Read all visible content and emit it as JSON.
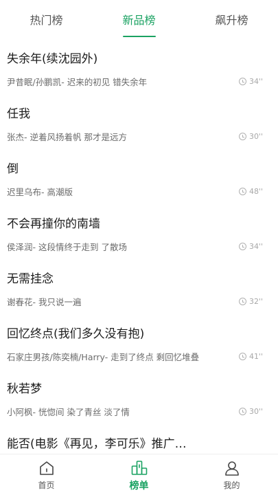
{
  "tabs": [
    {
      "label": "热门榜",
      "active": false
    },
    {
      "label": "新品榜",
      "active": true
    },
    {
      "label": "飙升榜",
      "active": false
    }
  ],
  "songs": [
    {
      "title": "失余年(续沈园外)",
      "subtitle": "尹昔眠/孙鹏凯- 迟来的初见 错失余年",
      "duration": "34''"
    },
    {
      "title": "任我",
      "subtitle": "张杰- 逆着风扬着帆 那才是远方",
      "duration": "30''"
    },
    {
      "title": "倒",
      "subtitle": "迟里乌布- 高潮版",
      "duration": "48''"
    },
    {
      "title": "不会再撞你的南墙",
      "subtitle": "侯泽润- 这段情终于走到 了散场",
      "duration": "34''"
    },
    {
      "title": "无需挂念",
      "subtitle": "谢春花- 我只说一遍",
      "duration": "32''"
    },
    {
      "title": "回忆终点(我们多久没有抱)",
      "subtitle": "石家庄男孩/陈奕楠/Harry- 走到了终点 剩回忆堆叠",
      "duration": "41''"
    },
    {
      "title": "秋若梦",
      "subtitle": "小阿枫- 恍惚间 染了青丝 淡了情",
      "duration": "30''"
    },
    {
      "title": "能否(电影《再见，李可乐》推广…",
      "subtitle": "",
      "duration": ""
    }
  ],
  "bottom_nav": [
    {
      "label": "首页",
      "icon": "home-icon",
      "active": false
    },
    {
      "label": "榜单",
      "icon": "chart-icon",
      "active": true
    },
    {
      "label": "我的",
      "icon": "profile-icon",
      "active": false
    }
  ],
  "colors": {
    "accent": "#1aa262",
    "text": "#1c1c1c",
    "subtext": "#6b6b6b"
  }
}
